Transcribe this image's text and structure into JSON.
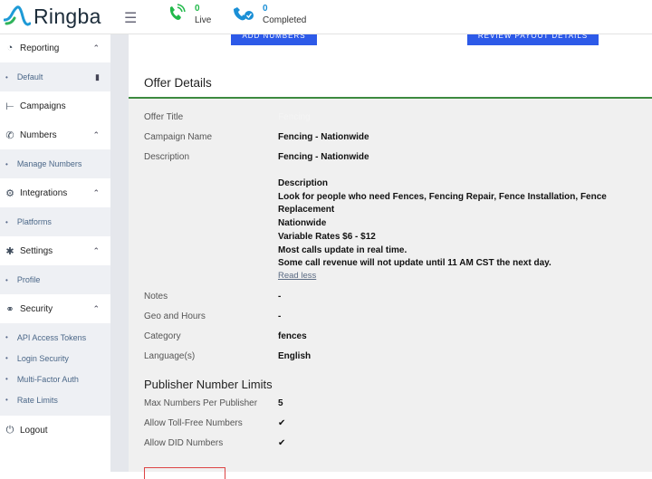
{
  "app": {
    "logo_text": "Ringba"
  },
  "topbar": {
    "live": {
      "count": "0",
      "label": "Live"
    },
    "completed": {
      "count": "0",
      "label": "Completed"
    }
  },
  "sidebar": {
    "sections": [
      {
        "label": "Reporting",
        "icon": "pie-chart-icon",
        "expanded": true,
        "items": [
          {
            "label": "Default"
          }
        ]
      },
      {
        "label": "Campaigns",
        "icon": "sitemap-icon",
        "items": []
      },
      {
        "label": "Numbers",
        "icon": "phone-icon",
        "expanded": true,
        "items": [
          {
            "label": "Manage Numbers"
          }
        ]
      },
      {
        "label": "Integrations",
        "icon": "gears-icon",
        "expanded": true,
        "items": [
          {
            "label": "Platforms"
          }
        ]
      },
      {
        "label": "Settings",
        "icon": "gear-icon",
        "expanded": true,
        "items": [
          {
            "label": "Profile"
          }
        ]
      },
      {
        "label": "Security",
        "icon": "key-icon",
        "expanded": true,
        "items": [
          {
            "label": "API Access Tokens"
          },
          {
            "label": "Login Security"
          },
          {
            "label": "Multi-Factor Auth"
          },
          {
            "label": "Rate Limits"
          }
        ]
      },
      {
        "label": "Logout",
        "icon": "power-icon",
        "items": []
      }
    ]
  },
  "main": {
    "buttons": {
      "add_numbers": "ADD NUMBERS",
      "review_payout": "REVIEW PAYOUT DETAILS"
    },
    "offer_details": {
      "title": "Offer Details",
      "rows": {
        "offer_title": {
          "label": "Offer Title",
          "value": "Fencing"
        },
        "campaign_name": {
          "label": "Campaign Name",
          "value": "Fencing - Nationwide"
        },
        "description": {
          "label": "Description",
          "value": "Fencing - Nationwide"
        },
        "notes": {
          "label": "Notes",
          "value": "-"
        },
        "geo": {
          "label": "Geo and Hours",
          "value": "-"
        },
        "category": {
          "label": "Category",
          "value": "fences"
        },
        "language": {
          "label": "Language(s)",
          "value": "English"
        }
      },
      "description_lines": [
        "Description",
        "Look for people who need Fences, Fencing Repair, Fence Installation, Fence Replacement",
        "Nationwide",
        "Variable Rates $6 - $12",
        "Most calls update in real time.",
        "Some call revenue will not update until 11 AM CST the next day."
      ],
      "read_less": "Read less"
    },
    "publisher_limits": {
      "title": "Publisher Number Limits",
      "max_numbers": {
        "label": "Max Numbers Per Publisher",
        "value": "5"
      },
      "toll_free": {
        "label": "Allow Toll-Free Numbers",
        "value": "✔"
      },
      "did": {
        "label": "Allow DID Numbers",
        "value": "✔"
      }
    }
  },
  "colors": {
    "accent_green": "#3d8a3f",
    "button_blue": "#2d5ae8",
    "live_green": "#21b94a",
    "completed_blue": "#1a8fd6",
    "danger_red": "#d44"
  }
}
